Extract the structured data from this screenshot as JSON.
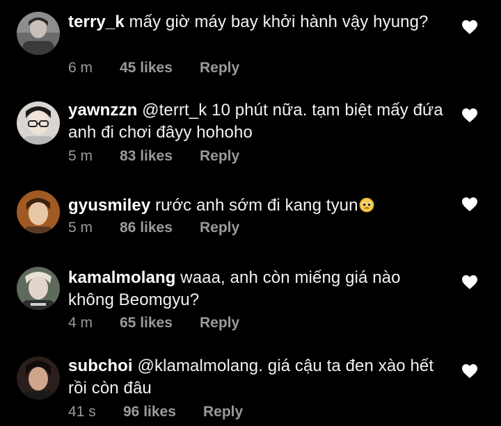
{
  "comments": [
    {
      "username": "terry_k",
      "text": "mấy giờ máy bay khởi hành vậy hyung?",
      "time": "6 m",
      "likes": "45 likes",
      "reply": "Reply",
      "avatar_icon": "avatar-photo-icon",
      "heart_icon": "heart-icon"
    },
    {
      "username": "yawnzzn",
      "text": "@terrt_k 10 phút nữa. tạm biệt mấy đứa anh đi chơi đâyy hohoho",
      "time": "5 m",
      "likes": "83 likes",
      "reply": "Reply",
      "avatar_icon": "avatar-photo-icon",
      "heart_icon": "heart-icon"
    },
    {
      "username": "gyusmiley",
      "text": "rước anh sớm đi kang tyun",
      "emoji": "pleading-face-emoji",
      "time": "5 m",
      "likes": "86 likes",
      "reply": "Reply",
      "avatar_icon": "avatar-photo-icon",
      "heart_icon": "heart-icon"
    },
    {
      "username": "kamalmolang",
      "text": "waaa, anh còn miếng giá nào không Beomgyu?",
      "time": "4 m",
      "likes": "65 likes",
      "reply": "Reply",
      "avatar_icon": "avatar-photo-icon",
      "heart_icon": "heart-icon"
    },
    {
      "username": "subchoi",
      "text": "@klamalmolang. giá cậu ta đen xào hết rồi còn đâu",
      "time": "41 s",
      "likes": "96 likes",
      "reply": "Reply",
      "avatar_icon": "avatar-photo-icon",
      "heart_icon": "heart-icon"
    }
  ],
  "colors": {
    "background": "#000000",
    "text": "#f2f2f2",
    "meta": "#9a9a9a",
    "heart": "#ffffff"
  }
}
